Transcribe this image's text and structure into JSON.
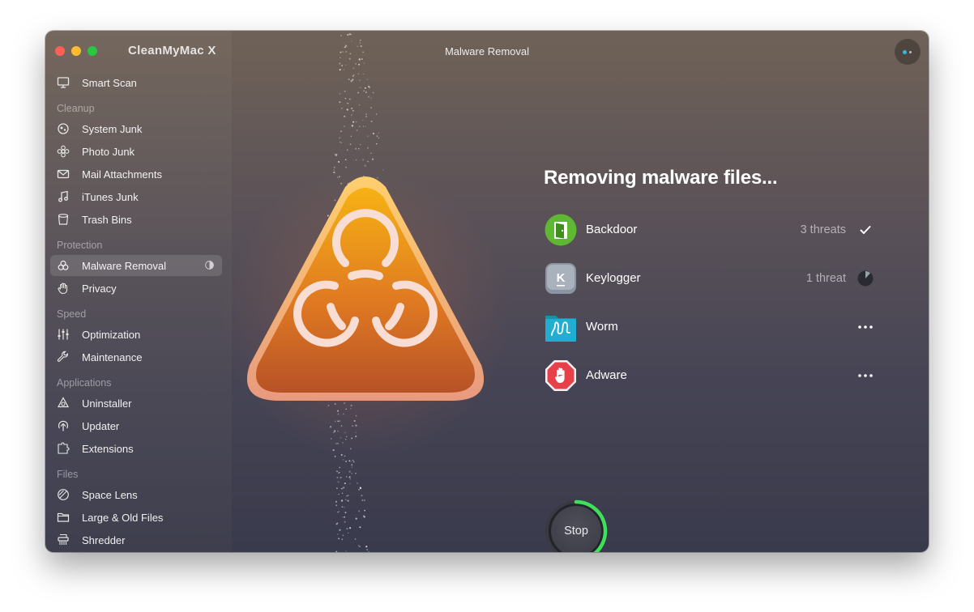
{
  "app": {
    "name": "CleanMyMac X",
    "window_title": "Malware Removal"
  },
  "sidebar": {
    "top_item": {
      "label": "Smart Scan",
      "icon": "smart-scan-icon"
    },
    "sections": [
      {
        "title": "Cleanup",
        "items": [
          {
            "label": "System Junk",
            "icon": "system-junk-icon"
          },
          {
            "label": "Photo Junk",
            "icon": "photo-junk-icon"
          },
          {
            "label": "Mail Attachments",
            "icon": "mail-icon"
          },
          {
            "label": "iTunes Junk",
            "icon": "music-note-icon"
          },
          {
            "label": "Trash Bins",
            "icon": "trash-icon"
          }
        ]
      },
      {
        "title": "Protection",
        "items": [
          {
            "label": "Malware Removal",
            "icon": "biohazard-icon",
            "active": true,
            "progress": 0.5
          },
          {
            "label": "Privacy",
            "icon": "hand-icon"
          }
        ]
      },
      {
        "title": "Speed",
        "items": [
          {
            "label": "Optimization",
            "icon": "sliders-icon"
          },
          {
            "label": "Maintenance",
            "icon": "wrench-icon"
          }
        ]
      },
      {
        "title": "Applications",
        "items": [
          {
            "label": "Uninstaller",
            "icon": "uninstaller-icon"
          },
          {
            "label": "Updater",
            "icon": "updater-icon"
          },
          {
            "label": "Extensions",
            "icon": "extensions-icon"
          }
        ]
      },
      {
        "title": "Files",
        "items": [
          {
            "label": "Space Lens",
            "icon": "space-lens-icon"
          },
          {
            "label": "Large & Old Files",
            "icon": "folder-icon"
          },
          {
            "label": "Shredder",
            "icon": "shredder-icon"
          }
        ]
      }
    ]
  },
  "main": {
    "title": "Removing malware files...",
    "threats": [
      {
        "name": "Backdoor",
        "count": "3 threats",
        "status": "done",
        "icon": "backdoor-icon",
        "color": "#5fb832"
      },
      {
        "name": "Keylogger",
        "count": "1 threat",
        "status": "in-progress",
        "icon": "keylogger-icon",
        "color": "#8a95a3"
      },
      {
        "name": "Worm",
        "count": "",
        "status": "pending",
        "icon": "worm-icon",
        "color": "#1fa7c4"
      },
      {
        "name": "Adware",
        "count": "",
        "status": "pending",
        "icon": "adware-icon",
        "color": "#e8404a"
      }
    ],
    "stop_label": "Stop",
    "progress": 0.42
  },
  "colors": {
    "accent_green": "#3ee05a",
    "hazard_orange": "#f0a020"
  }
}
